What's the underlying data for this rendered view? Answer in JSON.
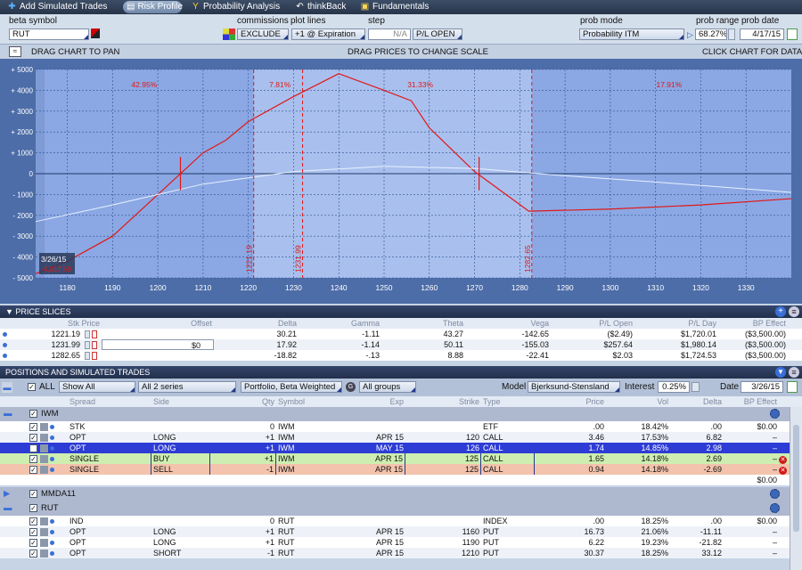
{
  "tabs": [
    {
      "label": "Add Simulated Trades",
      "icon": "plus-icon"
    },
    {
      "label": "Risk Profile",
      "icon": "chart-icon"
    },
    {
      "label": "Probability Analysis",
      "icon": "probability-icon"
    },
    {
      "label": "thinkBack",
      "icon": "thinkback-icon"
    },
    {
      "label": "Fundamentals",
      "icon": "fundamentals-icon"
    }
  ],
  "controls": {
    "beta_symbol_label": "beta symbol",
    "beta_symbol_value": "RUT",
    "commissions_label": "commissions",
    "commissions_value": "EXCLUDE",
    "plot_lines_label": "plot lines",
    "plot_lines_value": "+1 @ Expiration",
    "step_label": "step",
    "step_value": "N/A",
    "pl_open": "P/L OPEN",
    "prob_mode_label": "prob mode",
    "prob_mode_value": "Probability ITM",
    "prob_range_label": "prob range",
    "prob_range_value": "68.27%",
    "prob_date_label": "prob date",
    "prob_date_value": "4/17/15"
  },
  "toolbar": {
    "drag_pan": "DRAG CHART TO PAN",
    "drag_prices": "DRAG PRICES TO CHANGE SCALE",
    "click_chart": "CLICK CHART FOR DATA"
  },
  "chart_data": {
    "type": "line",
    "x_ticks": [
      1180,
      1190,
      1200,
      1210,
      1220,
      1230,
      1240,
      1250,
      1260,
      1270,
      1280,
      1290,
      1300,
      1310,
      1320,
      1330
    ],
    "y_ticks": [
      "+ 5000",
      "+ 4000",
      "+ 3000",
      "+ 2000",
      "+ 1000",
      "0",
      "- 1000",
      "- 2000",
      "- 3000",
      "- 4000",
      "- 5000"
    ],
    "xlim": [
      1173,
      1340
    ],
    "ylim": [
      -5000,
      5000
    ],
    "series": [
      {
        "color": "#e01818",
        "x": [
          1173,
          1180,
          1190,
          1200,
          1210,
          1215,
          1220,
          1230,
          1240,
          1250,
          1256,
          1260,
          1270,
          1282,
          1300,
          1320,
          1340
        ],
        "y": [
          -4800,
          -4200,
          -3000,
          -1000,
          1000,
          1600,
          2500,
          3700,
          4800,
          4000,
          3500,
          2200,
          100,
          -1800,
          -1700,
          -1500,
          -1200
        ]
      },
      {
        "color": "#e8f0ff",
        "x": [
          1173,
          1190,
          1210,
          1230,
          1250,
          1270,
          1290,
          1310,
          1340
        ],
        "y": [
          -2300,
          -1500,
          -500,
          100,
          350,
          250,
          -100,
          -400,
          -900
        ]
      }
    ],
    "pct_labels": [
      {
        "x": 1197,
        "text": "42.95%"
      },
      {
        "x": 1227,
        "text": "7.81%"
      },
      {
        "x": 1258,
        "text": "31.33%"
      },
      {
        "x": 1313,
        "text": "17.91%"
      }
    ],
    "vlines": [
      {
        "x": 1221.19,
        "label": "1221.19"
      },
      {
        "x": 1231.99,
        "label": "1231.99"
      },
      {
        "x": 1282.65,
        "label": "1282.65"
      }
    ],
    "date_badge": "3/26/15",
    "date_badge_sub": "-4,017.59"
  },
  "price_slices": {
    "title": "PRICE SLICES",
    "headers": [
      "Stk Price",
      "Offset",
      "Delta",
      "Gamma",
      "Theta",
      "Vega",
      "P/L Open",
      "P/L Day",
      "BP Effect"
    ],
    "rows": [
      [
        "1221.19",
        "",
        "30.21",
        "-1.11",
        "43.27",
        "-142.65",
        "($2.49)",
        "$1,720.01",
        "($3,500.00)"
      ],
      [
        "1231.99",
        "$0",
        "17.92",
        "-1.14",
        "50.11",
        "-155.03",
        "$257.64",
        "$1,980.14",
        "($3,500.00)"
      ],
      [
        "1282.65",
        "",
        "-18.82",
        "-.13",
        "8.88",
        "-22.41",
        "$2.03",
        "$1,724.53",
        "($3,500.00)"
      ]
    ]
  },
  "positions": {
    "title": "POSITIONS AND SIMULATED TRADES",
    "filter_all": "ALL",
    "show_all": "Show All",
    "all_series": "All 2 series",
    "portfolio": "Portfolio, Beta Weighted",
    "all_groups": "All groups",
    "model_label": "Model",
    "model_value": "Bjerksund-Stensland",
    "interest_label": "Interest",
    "interest_value": "0.25%",
    "date_label": "Date",
    "date_value": "3/26/15",
    "headers": [
      "Spread",
      "Side",
      "Qty",
      "Symbol",
      "Exp",
      "Strike",
      "Type",
      "Price",
      "Vol",
      "Delta",
      "BP Effect"
    ],
    "groups": [
      {
        "name": "IWM",
        "rows": [
          [
            "STK",
            "",
            "0",
            "IWM",
            "",
            "",
            "ETF",
            ".00",
            "18.42%",
            ".00",
            "$0.00"
          ],
          [
            "OPT",
            "LONG",
            "+1",
            "IWM",
            "APR 15",
            "120",
            "CALL",
            "3.46",
            "17.53%",
            "6.82",
            "–"
          ],
          [
            "OPT",
            "LONG",
            "+1",
            "IWM",
            "MAY 15",
            "126",
            "CALL",
            "1.74",
            "14.85%",
            "2.98",
            "–"
          ],
          [
            "SINGLE",
            "BUY",
            "+1",
            "IWM",
            "APR 15",
            "125",
            "CALL",
            "1.65",
            "14.18%",
            "2.69",
            "–"
          ],
          [
            "SINGLE",
            "SELL",
            "-1",
            "IWM",
            "APR 15",
            "125",
            "CALL",
            "0.94",
            "14.18%",
            "-2.69",
            "–"
          ]
        ],
        "total": "$0.00"
      },
      {
        "name": "MMDA11",
        "rows": []
      },
      {
        "name": "RUT",
        "rows": [
          [
            "IND",
            "",
            "0",
            "RUT",
            "",
            "",
            "INDEX",
            ".00",
            "18.25%",
            ".00",
            "$0.00"
          ],
          [
            "OPT",
            "LONG",
            "+1",
            "RUT",
            "APR 15",
            "1160",
            "PUT",
            "16.73",
            "21.06%",
            "-11.11",
            "–"
          ],
          [
            "OPT",
            "LONG",
            "+1",
            "RUT",
            "APR 15",
            "1190",
            "PUT",
            "6.22",
            "19.23%",
            "-21.82",
            "–"
          ],
          [
            "OPT",
            "SHORT",
            "-1",
            "RUT",
            "APR 15",
            "1210",
            "PUT",
            "30.37",
            "18.25%",
            "33.12",
            "–"
          ]
        ]
      }
    ]
  }
}
